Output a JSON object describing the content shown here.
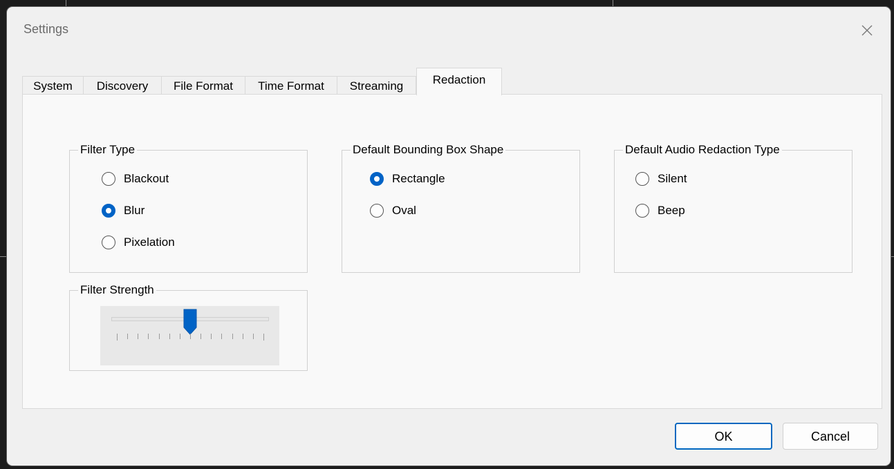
{
  "window": {
    "title": "Settings"
  },
  "tabs": [
    {
      "label": "System"
    },
    {
      "label": "Discovery"
    },
    {
      "label": "File Format"
    },
    {
      "label": "Time Format"
    },
    {
      "label": "Streaming"
    },
    {
      "label": "Redaction"
    }
  ],
  "active_tab": "Redaction",
  "filter_type": {
    "label": "Filter Type",
    "options": [
      "Blackout",
      "Blur",
      "Pixelation"
    ],
    "selected": "Blur"
  },
  "bounding_box": {
    "label": "Default Bounding Box Shape",
    "options": [
      "Rectangle",
      "Oval"
    ],
    "selected": "Rectangle"
  },
  "audio_redaction": {
    "label": "Default Audio Redaction Type",
    "options": [
      "Silent",
      "Beep"
    ],
    "selected": null
  },
  "filter_strength": {
    "label": "Filter Strength",
    "min": 0,
    "max": 10,
    "value": 5,
    "tick_count": 11
  },
  "buttons": {
    "ok_label": "OK",
    "cancel_label": "Cancel"
  },
  "colors": {
    "accent": "#0063c6",
    "window_bg": "#f0f0f0",
    "panel_bg": "#f9f9f9"
  },
  "icons": {
    "close": "close-icon",
    "slider_thumb": "slider-thumb-icon"
  }
}
